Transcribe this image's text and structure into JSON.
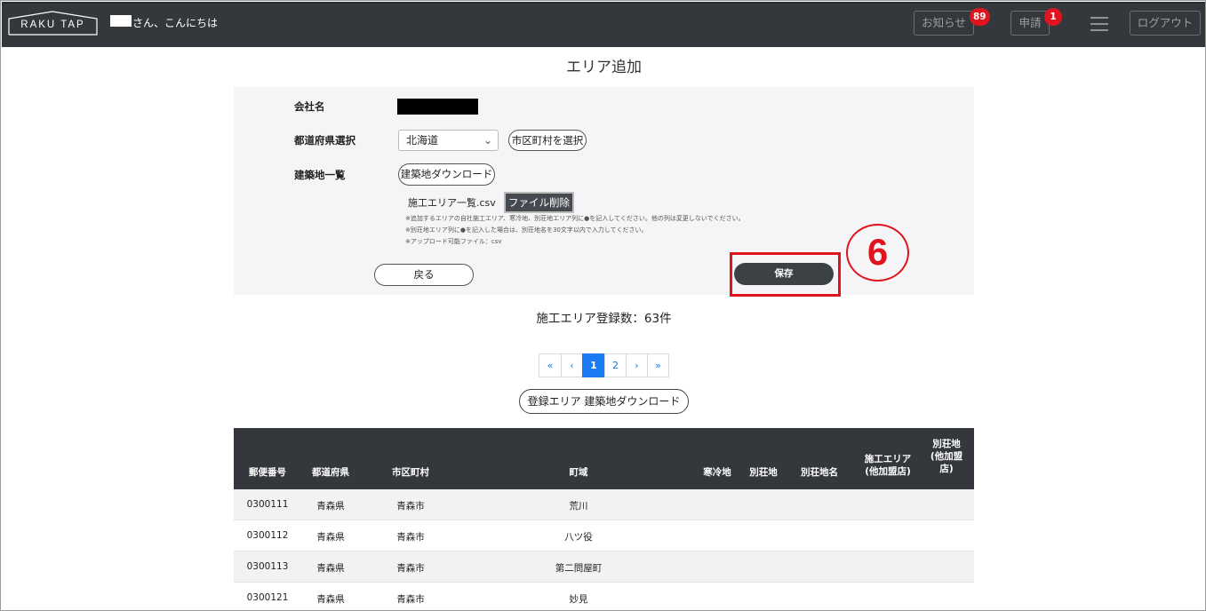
{
  "header": {
    "logo": "RAKU TAP",
    "greeting": "さん、こんにちは",
    "news_label": "お知らせ",
    "news_count": "89",
    "apply_label": "申請",
    "apply_count": "1",
    "logout_label": "ログアウト"
  },
  "page": {
    "title": "エリア追加"
  },
  "form": {
    "company_label": "会社名",
    "prefecture_label": "都道府県選択",
    "prefecture_value": "北海道",
    "city_button": "市区町村を選択",
    "site_list_label": "建築地一覧",
    "site_download_button": "建築地ダウンロード",
    "file_name": "施工エリア一覧.csv",
    "delete_file_button": "ファイル削除",
    "notes": [
      "※追加するエリアの自社施工エリア、寒冷地、別荘地エリア列に●を記入してください。他の列は変更しないでください。",
      "※別荘地エリア列に●を記入した場合は、別荘地名を30文字以内で入力してください。",
      "※アップロード可能ファイル：csv"
    ],
    "back_button": "戻る",
    "save_button": "保存",
    "step_number": "6"
  },
  "summary": {
    "count_text": "施工エリア登録数：63件"
  },
  "pagination": {
    "first": "«",
    "prev": "‹",
    "pages": [
      "1",
      "2"
    ],
    "next": "›",
    "last": "»",
    "current": "1"
  },
  "download_registered_button": "登録エリア 建築地ダウンロード",
  "table": {
    "headers": {
      "zip": "郵便番号",
      "prefecture": "都道府県",
      "city": "市区町村",
      "town": "町域",
      "cold": "寒冷地",
      "villa": "別荘地",
      "villa_name": "別荘地名",
      "area_line1": "施工エリア",
      "area_line2": "(他加盟店)",
      "villa_other_line1": "別荘地",
      "villa_other_line2": "(他加盟",
      "villa_other_line3": "店)"
    },
    "rows": [
      {
        "zip": "0300111",
        "prefecture": "青森県",
        "city": "青森市",
        "town": "荒川"
      },
      {
        "zip": "0300112",
        "prefecture": "青森県",
        "city": "青森市",
        "town": "八ツ役"
      },
      {
        "zip": "0300113",
        "prefecture": "青森県",
        "city": "青森市",
        "town": "第二問屋町"
      },
      {
        "zip": "0300121",
        "prefecture": "青森県",
        "city": "青森市",
        "town": "妙見"
      }
    ]
  },
  "colors": {
    "header_bg": "#34383d",
    "badge": "#e0141e",
    "accent": "#1a7bf2",
    "highlight": "#e0141e"
  }
}
